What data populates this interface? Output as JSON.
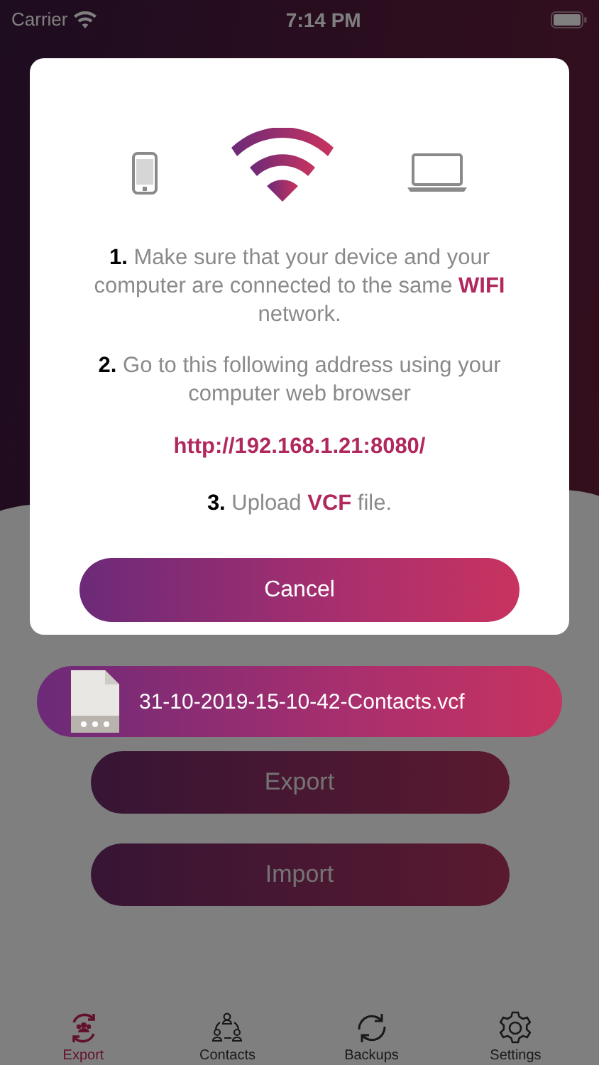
{
  "status_bar": {
    "carrier": "Carrier",
    "time": "7:14 PM"
  },
  "dialog": {
    "steps": [
      "**1.** Make sure that your device and your computer are connected to the same **WIFI** network.",
      "**2.** Go to this following address using your computer web browser"
    ],
    "address": "http://192.168.1.21:8080/",
    "last_step": "**3.** Upload **VCF** file.",
    "cancel": "Cancel"
  },
  "file": {
    "name": "31-10-2019-15-10-42-Contacts.vcf"
  },
  "buttons": [
    "Export",
    "Import"
  ],
  "tabs": [
    {
      "label": "Export",
      "kind": "export",
      "selected": true
    },
    {
      "label": "Contacts",
      "kind": "contacts",
      "selected": false
    },
    {
      "label": "Backups",
      "kind": "backups",
      "selected": false
    },
    {
      "label": "Settings",
      "kind": "settings",
      "selected": false
    }
  ]
}
